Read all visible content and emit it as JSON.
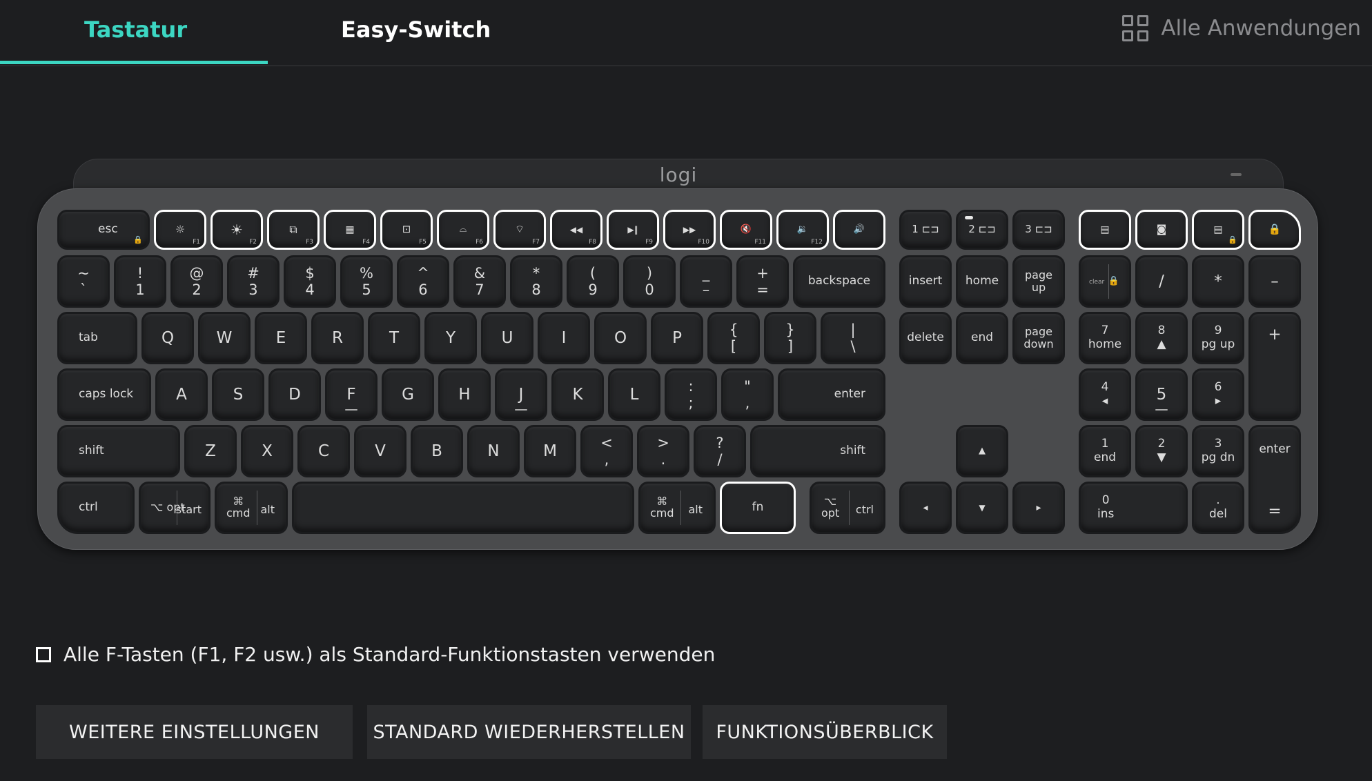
{
  "header": {
    "tabs": [
      {
        "label": "Tastatur",
        "active": true
      },
      {
        "label": "Easy-Switch",
        "active": false
      }
    ],
    "all_apps_label": "Alle Anwendungen",
    "all_apps_icon": "grid-icon",
    "accent_color": "#3cd6c2"
  },
  "keyboard": {
    "brand": "logi",
    "keys": {
      "esc": "esc",
      "f1": "F1",
      "f2": "F2",
      "f3": "F3",
      "f4": "F4",
      "f5": "F5",
      "f6": "F6",
      "f7": "F7",
      "f8": "F8",
      "f9": "F9",
      "f10": "F10",
      "f11": "F11",
      "f12": "F12",
      "easy1": "1",
      "easy2": "2",
      "easy3": "3",
      "tilde": "~\n`",
      "k1": "!\n1",
      "k2": "@\n2",
      "k3": "#\n3",
      "k4": "$\n4",
      "k5": "%\n5",
      "k6": "^\n6",
      "k7": "&\n7",
      "k8": "*\n8",
      "k9": "(\n9",
      "k0": ")\n0",
      "minus": "_\n–",
      "equal": "+\n=",
      "backspace": "backspace",
      "insert": "insert",
      "home": "home",
      "pageup": "page\nup",
      "clear": "clear",
      "np_slash": "/",
      "np_star": "*",
      "np_minus": "–",
      "tab": "tab",
      "q": "Q",
      "w": "W",
      "e": "E",
      "r": "R",
      "t": "T",
      "y": "Y",
      "u": "U",
      "i": "I",
      "o": "O",
      "p": "P",
      "lbracket": "{\n[",
      "rbracket": "}\n]",
      "backslash": "|\n\\",
      "delete": "delete",
      "end": "end",
      "pagedown": "page\ndown",
      "np7": "7\nhome",
      "np8": "8\n▲",
      "np9": "9\npg up",
      "np_plus": "+",
      "caps": "caps lock",
      "a": "A",
      "s": "S",
      "d": "D",
      "f": "F",
      "g": "G",
      "h": "H",
      "j": "J",
      "k": "K",
      "l": "L",
      "semicolon": ":\n;",
      "quote": "\"\n,",
      "enter": "enter",
      "np4": "4\n◂",
      "np5": "5",
      "np6": "6\n▸",
      "lshift": "shift",
      "z": "Z",
      "x": "X",
      "c": "C",
      "v": "V",
      "b": "B",
      "n": "N",
      "m": "M",
      "comma": "<\n,",
      "period": ">\n.",
      "slash": "?\n/",
      "rshift": "shift",
      "up": "▲",
      "np1": "1\nend",
      "np2": "2\n▼",
      "np3": "3\npg dn",
      "np_enter": "enter",
      "lctrl": "ctrl",
      "lopt": "⌥\nopt",
      "start": "start",
      "lcmd": "⌘\ncmd",
      "lalt": "alt",
      "rcmd": "⌘\ncmd",
      "ralt": "alt",
      "fn": "fn",
      "ropt": "⌥\nopt",
      "rctrl": "ctrl",
      "left": "◂",
      "down": "▼",
      "right": "▸",
      "np0": "0\nins",
      "np_dot": ".\ndel",
      "np_equal": "="
    }
  },
  "options": {
    "fkeys_checkbox_label": "Alle F-Tasten (F1, F2 usw.) als Standard-Funktionstasten verwenden",
    "fkeys_checked": false
  },
  "buttons": {
    "more_settings": "WEITERE EINSTELLUNGEN",
    "restore_default": "STANDARD WIEDERHERSTELLEN",
    "function_overview": "FUNKTIONSÜBERBLICK"
  }
}
